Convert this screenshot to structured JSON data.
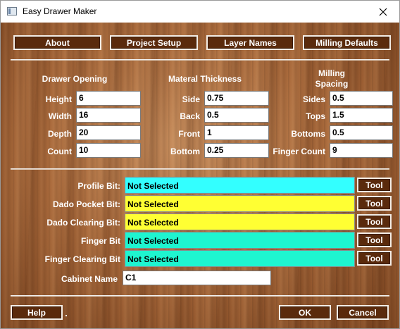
{
  "window": {
    "title": "Easy Drawer Maker"
  },
  "top_buttons": {
    "about": "About",
    "project_setup": "Project Setup",
    "layer_names": "Layer Names",
    "milling_defaults": "Milling Defaults"
  },
  "drawer_opening": {
    "header": "Drawer Opening",
    "height_label": "Height",
    "height_value": "6",
    "width_label": "Width",
    "width_value": "16",
    "depth_label": "Depth",
    "depth_value": "20",
    "count_label": "Count",
    "count_value": "10"
  },
  "material_thickness": {
    "header": "Materal Thickness",
    "side_label": "Side",
    "side_value": "0.75",
    "back_label": "Back",
    "back_value": "0.5",
    "front_label": "Front",
    "front_value": "1",
    "bottom_label": "Bottom",
    "bottom_value": "0.25"
  },
  "milling_spacing": {
    "header": "Milling Spacing",
    "sides_label": "Sides",
    "sides_value": "0.5",
    "tops_label": "Tops",
    "tops_value": "1.5",
    "bottoms_label": "Bottoms",
    "bottoms_value": "0.5",
    "finger_count_label": "Finger Count",
    "finger_count_value": "9"
  },
  "bits": {
    "profile_label": "Profile Bit:",
    "profile_value": "Not Selected",
    "dado_pocket_label": "Dado Pocket Bit:",
    "dado_pocket_value": "Not Selected",
    "dado_clearing_label": "Dado Clearing Bit:",
    "dado_clearing_value": "Not Selected",
    "finger_label": "Finger Bit",
    "finger_value": "Not Selected",
    "finger_clearing_label": "Finger Clearing Bit",
    "finger_clearing_value": "Not Selected",
    "tool_label": "Tool"
  },
  "cabinet": {
    "label": "Cabinet Name",
    "value": "C1"
  },
  "bottom_buttons": {
    "help": "Help",
    "ok": "OK",
    "cancel": "Cancel"
  },
  "colors": {
    "cyan": "#33ffff",
    "yellow": "#ffff33",
    "teal": "#1ef5d0",
    "button_bg": "#5a2a0c"
  },
  "icons": {
    "app": "app-window-icon",
    "close": "close-icon"
  }
}
